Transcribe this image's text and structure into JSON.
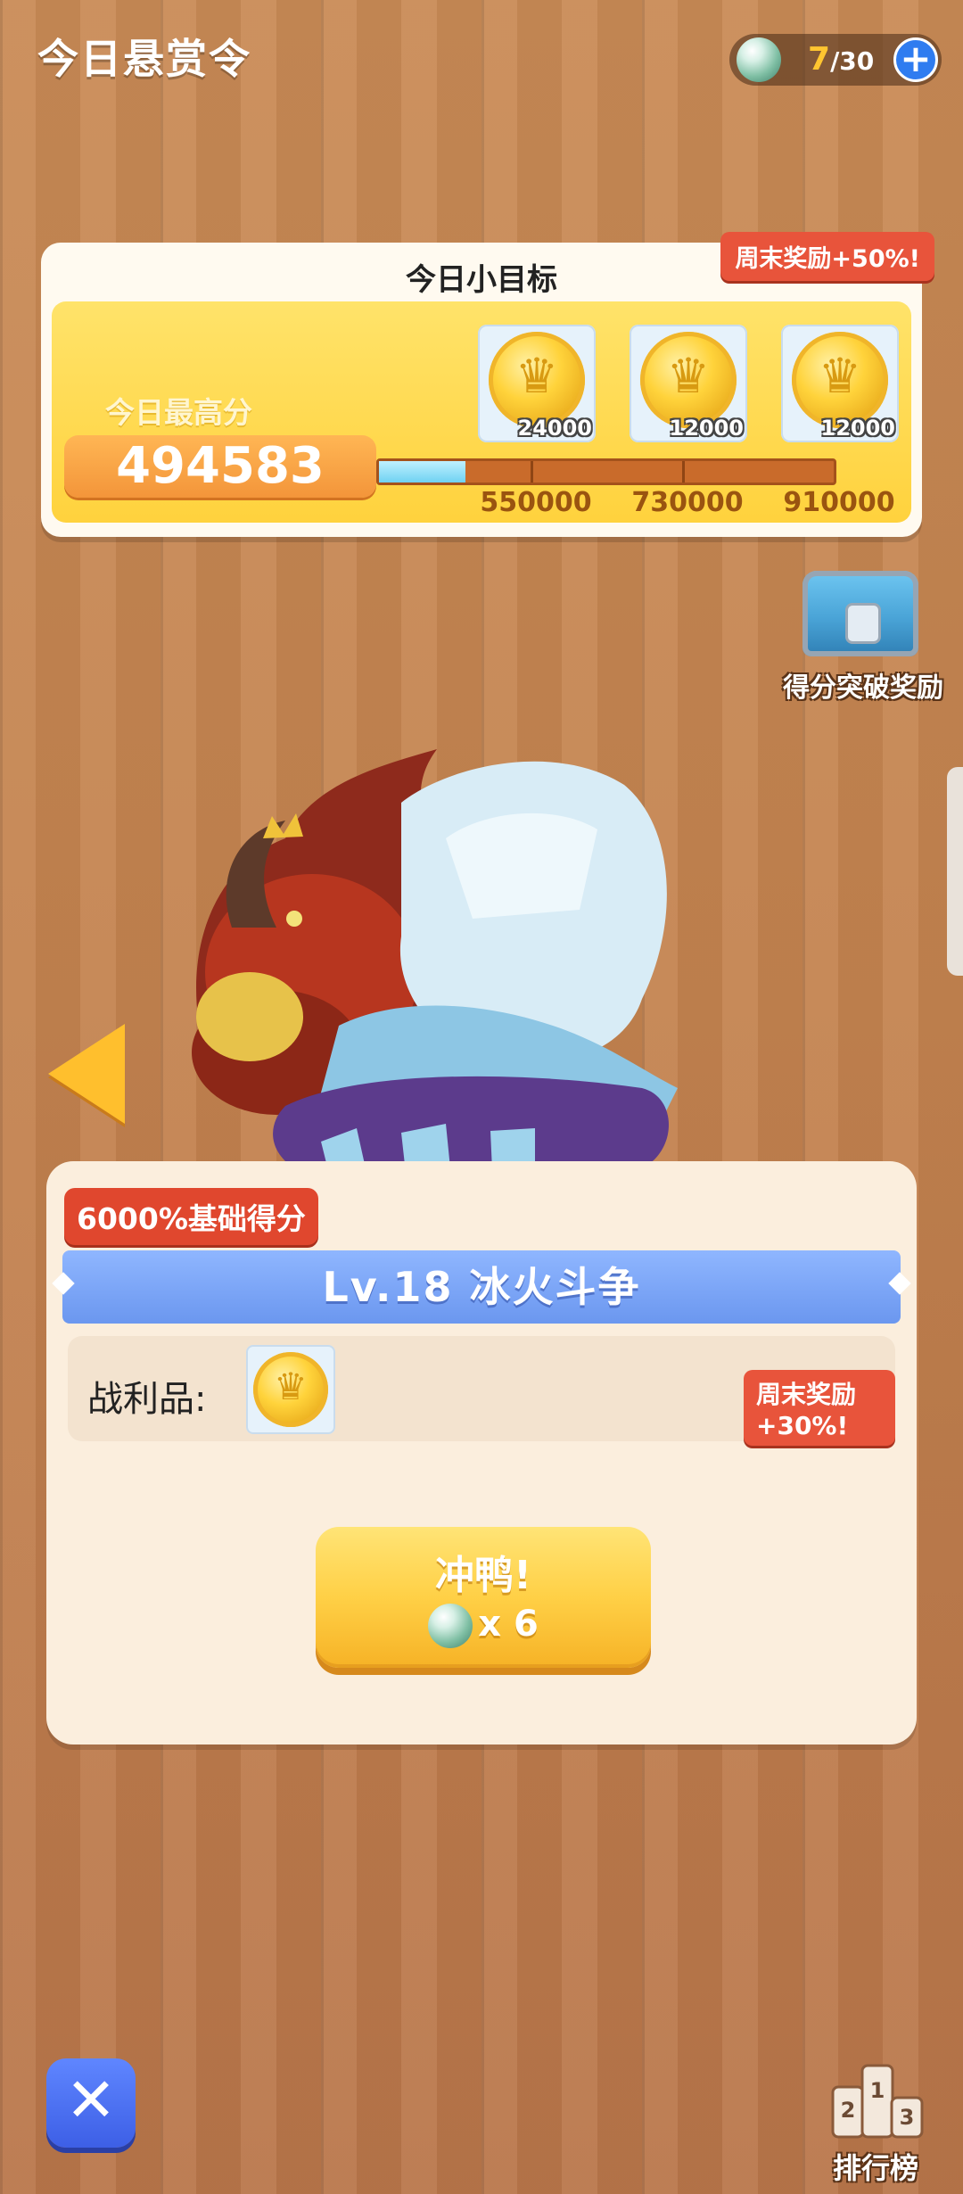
{
  "header": {
    "title": "今日悬赏令",
    "energy": {
      "current": "7",
      "max": "/30",
      "plus_icon": "plus-icon"
    }
  },
  "daily_goal": {
    "title": "今日小目标",
    "weekend_bonus": "周末奖励+50%!",
    "best_label": "今日最高分",
    "best_score": "494583",
    "progress": 0.19,
    "milestones": [
      {
        "score": "550000",
        "reward": "24000"
      },
      {
        "score": "730000",
        "reward": "12000"
      },
      {
        "score": "910000",
        "reward": "12000"
      }
    ]
  },
  "chest": {
    "label": "得分突破奖励"
  },
  "level": {
    "base_score_badge": "6000%基础得分",
    "title": "Lv.18  冰火斗争",
    "loot_label": "战利品:",
    "weekend_bonus": "周末奖励+30%!",
    "go_label": "冲鸭!",
    "go_cost": "x 6"
  },
  "bottom": {
    "close_icon": "close-icon",
    "rank_label": "排行榜",
    "podium": [
      "2",
      "1",
      "3"
    ]
  }
}
